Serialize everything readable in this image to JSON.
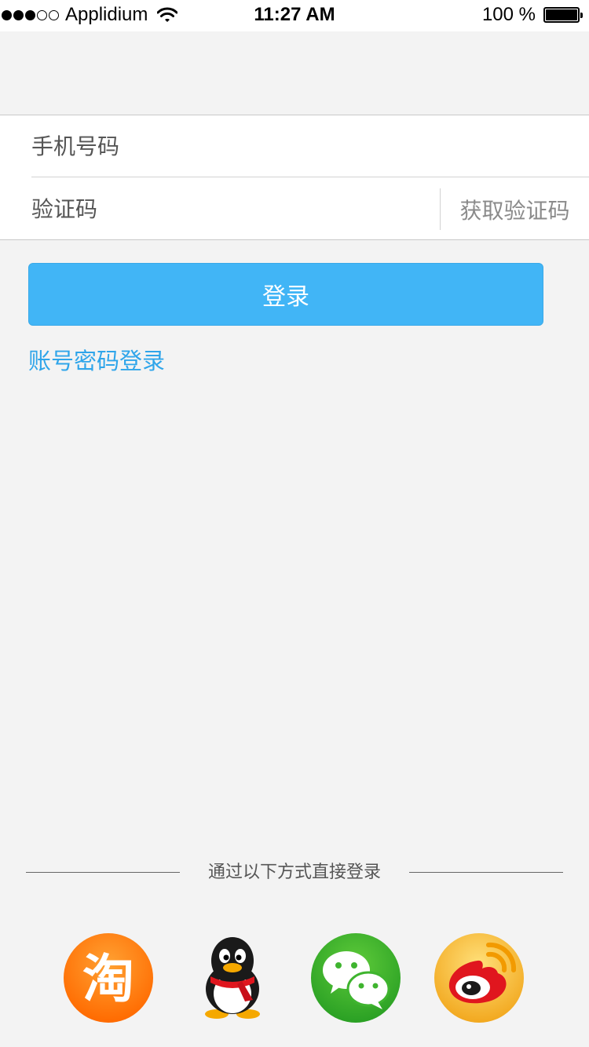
{
  "status_bar": {
    "signal_dots_filled": 3,
    "signal_dots_total": 5,
    "carrier": "Applidium",
    "time": "11:27 AM",
    "battery_text": "100 %",
    "battery_level": 1.0
  },
  "form": {
    "phone_placeholder": "手机号码",
    "code_placeholder": "验证码",
    "get_code_label": "获取验证码"
  },
  "login_button_label": "登录",
  "account_login_link": "账号密码登录",
  "social": {
    "divider_text": "通过以下方式直接登录",
    "providers": [
      {
        "name": "taobao-icon",
        "glyph": "淘"
      },
      {
        "name": "qq-icon"
      },
      {
        "name": "wechat-icon"
      },
      {
        "name": "weibo-icon"
      }
    ]
  },
  "colors": {
    "background": "#f3f3f3",
    "button_blue": "#41b5f6",
    "link_blue": "#2fa5ea",
    "taobao_orange": "#ff7a00",
    "wechat_green": "#3fb42f",
    "weibo_gold": "#f7b52b"
  }
}
